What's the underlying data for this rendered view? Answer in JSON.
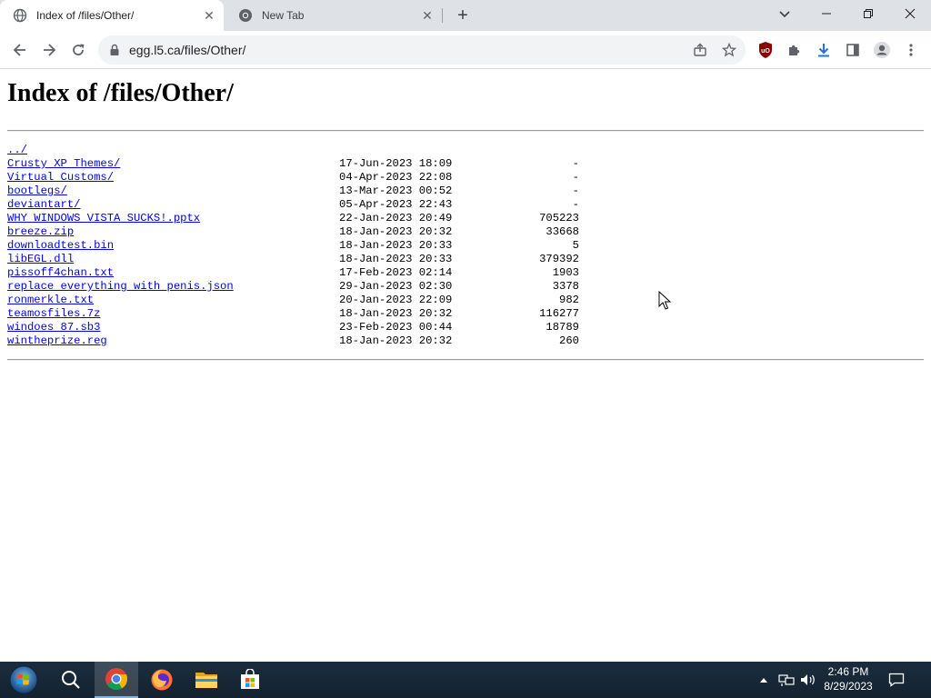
{
  "browser": {
    "tabs": [
      {
        "title": "Index of /files/Other/",
        "active": true
      },
      {
        "title": "New Tab",
        "active": false
      }
    ],
    "url": "egg.l5.ca/files/Other/"
  },
  "page": {
    "heading": "Index of /files/Other/",
    "entries": [
      {
        "name": "../",
        "date": "",
        "size": ""
      },
      {
        "name": "Crusty XP Themes/",
        "date": "17-Jun-2023 18:09",
        "size": "-"
      },
      {
        "name": "Virtual Customs/",
        "date": "04-Apr-2023 22:08",
        "size": "-"
      },
      {
        "name": "bootlegs/",
        "date": "13-Mar-2023 00:52",
        "size": "-"
      },
      {
        "name": "deviantart/",
        "date": "05-Apr-2023 22:43",
        "size": "-"
      },
      {
        "name": "WHY WINDOWS VISTA SUCKS!.pptx",
        "date": "22-Jan-2023 20:49",
        "size": "705223"
      },
      {
        "name": "breeze.zip",
        "date": "18-Jan-2023 20:32",
        "size": "33668"
      },
      {
        "name": "downloadtest.bin",
        "date": "18-Jan-2023 20:33",
        "size": "5"
      },
      {
        "name": "libEGL.dll",
        "date": "18-Jan-2023 20:33",
        "size": "379392"
      },
      {
        "name": "pissoff4chan.txt",
        "date": "17-Feb-2023 02:14",
        "size": "1903"
      },
      {
        "name": "replace everything with penis.json",
        "date": "29-Jan-2023 02:30",
        "size": "3378"
      },
      {
        "name": "ronmerkle.txt",
        "date": "20-Jan-2023 22:09",
        "size": "982"
      },
      {
        "name": "teamosfiles.7z",
        "date": "18-Jan-2023 20:32",
        "size": "116277"
      },
      {
        "name": "windoes 87.sb3",
        "date": "23-Feb-2023 00:44",
        "size": "18789"
      },
      {
        "name": "wintheprize.reg",
        "date": "18-Jan-2023 20:32",
        "size": "260"
      }
    ]
  },
  "taskbar": {
    "time": "2:46 PM",
    "date": "8/29/2023",
    "apps": [
      "start-orb-icon",
      "search-icon",
      "chrome-icon",
      "firefox-icon",
      "file-explorer-icon",
      "store-icon"
    ]
  },
  "colors": {
    "link": "#0000ee",
    "tabstrip": "#dee1e6",
    "ublock": "#8b0000",
    "download": "#1a73e8"
  }
}
